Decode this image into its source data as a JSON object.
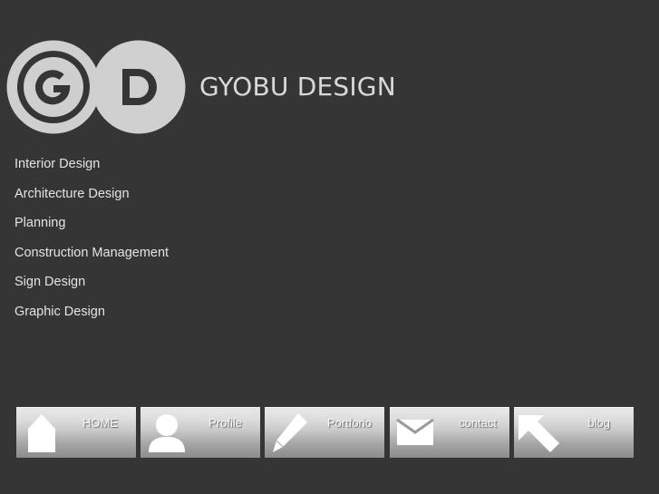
{
  "brand": {
    "logo_text": "GD",
    "name": "GYOBU DESIGN"
  },
  "services": [
    "Interior Design",
    "Architecture Design",
    "Planning",
    "Construction Management",
    "Sign Design",
    "Graphic Design"
  ],
  "nav": [
    {
      "label": "HOME",
      "icon": "house-icon"
    },
    {
      "label": "Profile",
      "icon": "person-icon"
    },
    {
      "label": "Portforio",
      "icon": "pencil-icon"
    },
    {
      "label": "contact",
      "icon": "envelope-icon"
    },
    {
      "label": "blog",
      "icon": "arrow-up-left-icon"
    }
  ],
  "colors": {
    "background": "#353535",
    "logo_light": "#d0d0d0",
    "text": "#e4e4e4",
    "button_top": "#e7e7e7",
    "button_bottom": "#8c8c8c"
  }
}
